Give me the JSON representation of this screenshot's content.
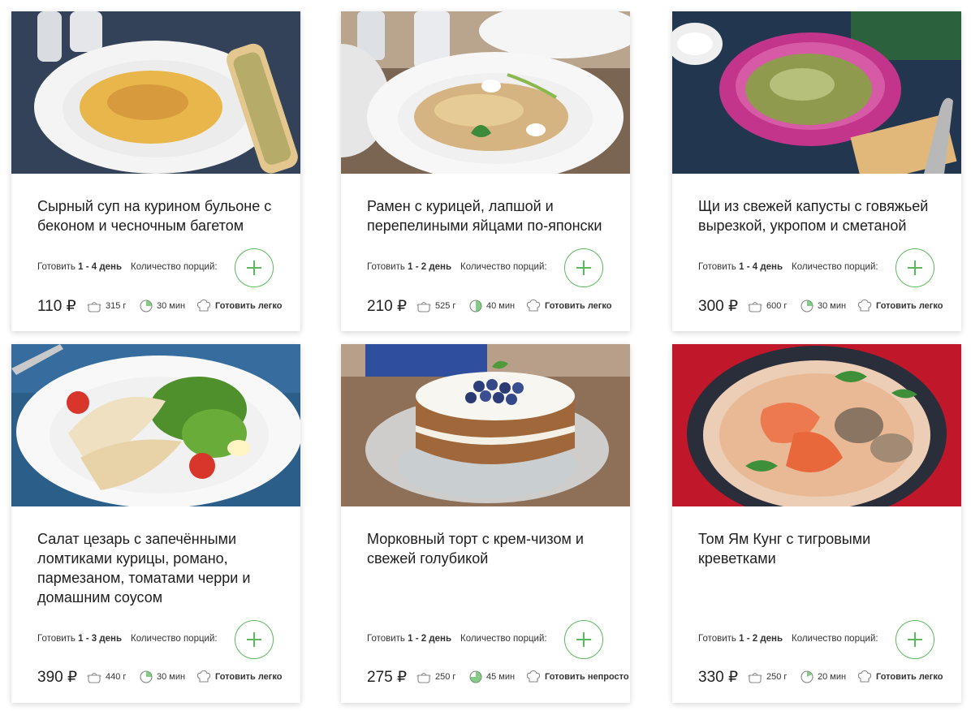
{
  "labels": {
    "cook_prefix": "Готовить",
    "portions": "Количество порций:",
    "currency": "₽"
  },
  "colors": {
    "accent": "#5cb85c"
  },
  "icons": {
    "weight": "pot-icon",
    "time": "clock-icon",
    "difficulty": "chef-hat-icon",
    "add": "plus-icon"
  },
  "cards": [
    {
      "title": "Сырный суп на курином бульоне с беконом и чесночным багетом",
      "cook_days": "1 - 4 день",
      "price": "110 ₽",
      "weight": "315 г",
      "time": "30 мин",
      "difficulty": "Готовить легко"
    },
    {
      "title": "Рамен с курицей, лапшой и перепелиными яйцами по-японски",
      "cook_days": "1 - 2 день",
      "price": "210 ₽",
      "weight": "525 г",
      "time": "40 мин",
      "difficulty": "Готовить легко"
    },
    {
      "title": "Щи из свежей капусты с говяжьей вырезкой, укропом и сметаной",
      "cook_days": "1 - 4 день",
      "price": "300 ₽",
      "weight": "600 г",
      "time": "30 мин",
      "difficulty": "Готовить легко"
    },
    {
      "title": "Салат цезарь с запечёнными ломтиками курицы, романо, пармезаном, томатами черри и домашним соусом",
      "cook_days": "1 - 3 день",
      "price": "390 ₽",
      "weight": "440 г",
      "time": "30 мин",
      "difficulty": "Готовить легко"
    },
    {
      "title": "Морковный торт с крем-чизом и свежей голубикой",
      "cook_days": "1 - 2 день",
      "price": "275 ₽",
      "weight": "250 г",
      "time": "45 мин",
      "difficulty": "Готовить непросто"
    },
    {
      "title": "Том Ям Кунг с тигровыми креветками",
      "cook_days": "1 - 2 день",
      "price": "330 ₽",
      "weight": "250 г",
      "time": "20 мин",
      "difficulty": "Готовить легко"
    }
  ]
}
